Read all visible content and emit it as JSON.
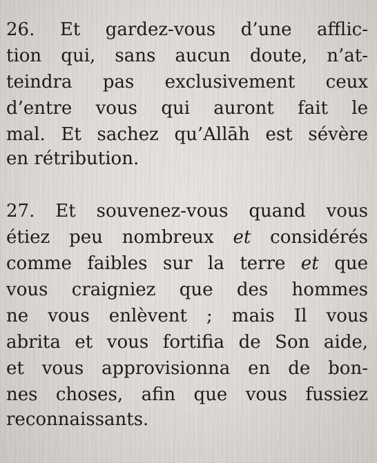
{
  "verse_26": {
    "lines": [
      "26. Et gardez-vous d’une afflic-",
      "tion qui, sans aucun doute, n’at-",
      "teindra pas exclusivement ceux",
      "d’entre vous qui auront fait le",
      "mal. Et sachez qu’Allāh est sévère",
      "en rétribution."
    ]
  },
  "verse_27": {
    "line_1": "27. Et souvenez-vous quand vous",
    "line_2": {
      "before": "étiez peu nombreux ",
      "italic": "et",
      "after": " considérés"
    },
    "line_3": {
      "before": "comme faibles sur la terre ",
      "italic": "et",
      "after": " que"
    },
    "line_4": "vous craigniez que des hommes",
    "line_5": "ne vous enlèvent ; mais Il vous",
    "line_6": "abrita et vous fortifia de Son aide,",
    "line_7": "et vous approvisionna en de bon-",
    "line_8": "nes choses, afin que vous fussiez",
    "line_9": "reconnaissants."
  }
}
